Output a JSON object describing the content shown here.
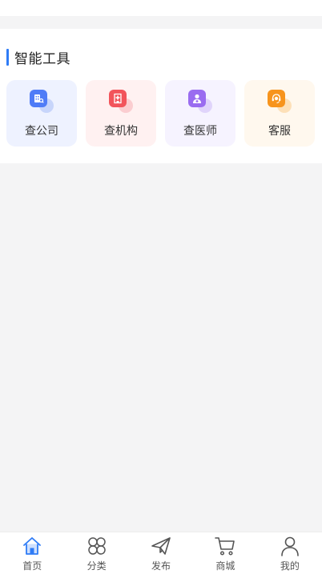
{
  "colors": {
    "accent": "#2f7cf6",
    "page_bg": "#f4f4f5",
    "inactive_tab": "#555555"
  },
  "tools": {
    "title": "智能工具",
    "items": [
      {
        "label": "查公司",
        "icon": "building-icon",
        "bg": "#eef2ff",
        "color": "#4f7cf7",
        "ghost": "#c7d5fb"
      },
      {
        "label": "查机构",
        "icon": "hospital-icon",
        "bg": "#fff1f1",
        "color": "#f2545b",
        "ghost": "#fbcdd0"
      },
      {
        "label": "查医师",
        "icon": "doctor-icon",
        "bg": "#f6f3ff",
        "color": "#9a6cf0",
        "ghost": "#e0d4fb"
      },
      {
        "label": "客服",
        "icon": "customer-service-icon",
        "bg": "#fff8ee",
        "color": "#f7941d",
        "ghost": "#fde0b8"
      }
    ]
  },
  "tabbar": {
    "items": [
      {
        "label": "首页",
        "icon": "home-icon",
        "active": true
      },
      {
        "label": "分类",
        "icon": "category-icon",
        "active": false
      },
      {
        "label": "发布",
        "icon": "publish-icon",
        "active": false
      },
      {
        "label": "商城",
        "icon": "cart-icon",
        "active": false
      },
      {
        "label": "我的",
        "icon": "user-icon",
        "active": false
      }
    ]
  }
}
